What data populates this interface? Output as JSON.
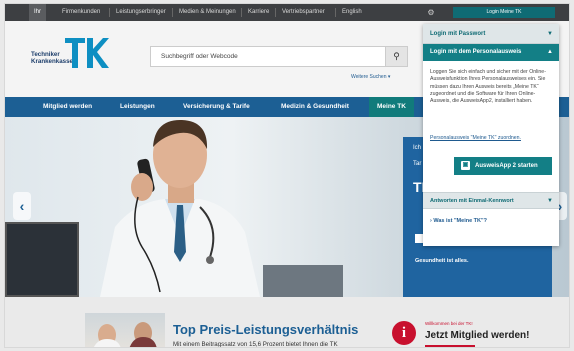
{
  "topnav": {
    "items": [
      "Ihr",
      "Firmenkunden",
      "Leistungserbringer",
      "Medien & Meinungen",
      "Karriere",
      "Vertriebspartner",
      "English"
    ],
    "login_button": "Login Meine TK"
  },
  "header": {
    "logo_line1": "Techniker",
    "logo_line2": "Krankenkasse",
    "search_placeholder": "Suchbegriff oder Webcode",
    "weitere_suchen": "Weitere Suchen"
  },
  "mainnav": {
    "items": [
      "Mitglied werden",
      "Leistungen",
      "Versicherung & Tarife",
      "Medizin & Gesundheit",
      "Meine TK"
    ]
  },
  "dropdown": {
    "row1": "Login mit Passwort",
    "row2": "Login mit dem Personalausweis",
    "body": "Loggen Sie sich einfach und sicher mit der Online-Ausweisfunktion Ihres Personalausweises ein. Sie müssen dazu Ihren Ausweis bereits „Meine TK“ zugeordnet und die Software für Ihren Online-Ausweis, die AusweisApp2, installiert haben.",
    "link": "Personalausweis \"Meine TK\" zuordnen.",
    "app_button": "AusweisApp 2 starten",
    "row3": "Antworten mit Einmal-Kennwort",
    "meine_tk": "Was ist \"Meine TK\"?"
  },
  "hero_card": {
    "line1": "Ich",
    "line2": "Tar",
    "big": "TK",
    "gesund": "Gesundheit ist alles."
  },
  "bottom": {
    "title": "Top Preis-Leistungsverhältnis",
    "subtitle": "Mit einem Beitragssatz von 15,6 Prozent bietet Ihnen die TK",
    "willkommen": "Willkommen bei der TK!",
    "mitglied": "Jetzt Mitglied werden!"
  },
  "colors": {
    "teal": "#137f86",
    "nav_blue": "#1c5f94",
    "topbar": "#3d3f42",
    "red": "#c8102e"
  }
}
